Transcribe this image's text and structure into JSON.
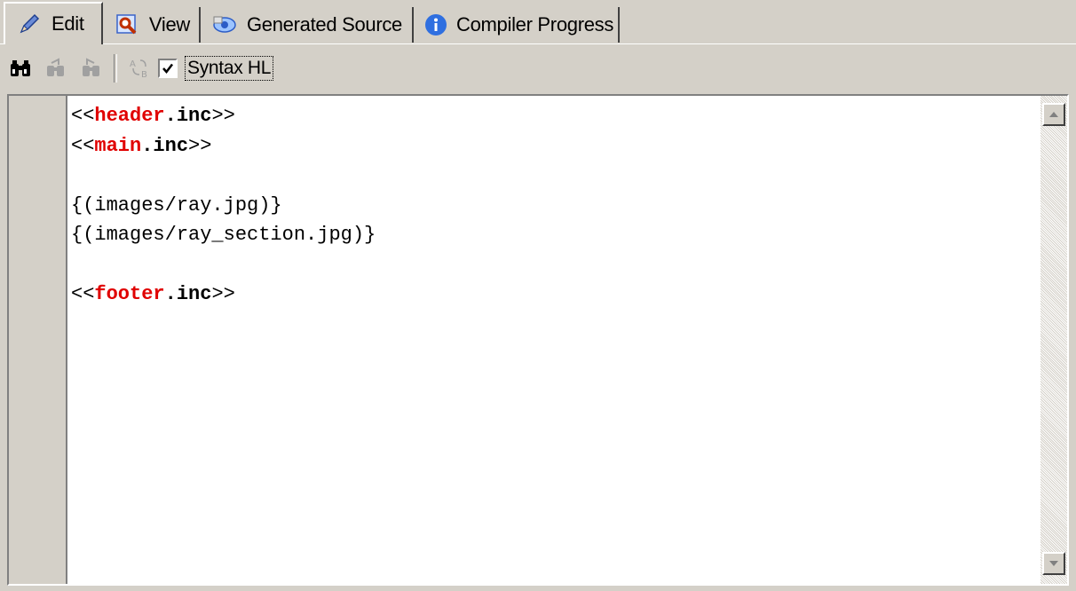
{
  "tabs": [
    {
      "label": "Edit",
      "icon": "pencil-icon",
      "active": true
    },
    {
      "label": "View",
      "icon": "magnifier-icon",
      "active": false
    },
    {
      "label": "Generated Source",
      "icon": "source-eye-icon",
      "active": false
    },
    {
      "label": "Compiler Progress",
      "icon": "info-icon",
      "active": false
    }
  ],
  "toolbar": {
    "find_icon": "binoculars-icon",
    "find_next_icon": "find-next-icon",
    "replace_icon": "find-replace-icon",
    "convert_icon": "convert-ab-icon",
    "syntax_checked": true,
    "syntax_label": "Syntax HL"
  },
  "editor": {
    "lines": [
      {
        "pre": "<<",
        "kw": "header",
        "dot": ".",
        "ext": "inc",
        "post": ">>"
      },
      {
        "pre": "<<",
        "kw": "main",
        "dot": ".",
        "ext": "inc",
        "post": ">>"
      },
      {
        "text": ""
      },
      {
        "text": "{(images/ray.jpg)}"
      },
      {
        "text": "{(images/ray_section.jpg)}"
      },
      {
        "text": ""
      },
      {
        "pre": "<<",
        "kw": "footer",
        "dot": ".",
        "ext": "inc",
        "post": ">>"
      }
    ]
  },
  "colors": {
    "keyword": "#e00000",
    "chrome": "#d4d0c8"
  }
}
